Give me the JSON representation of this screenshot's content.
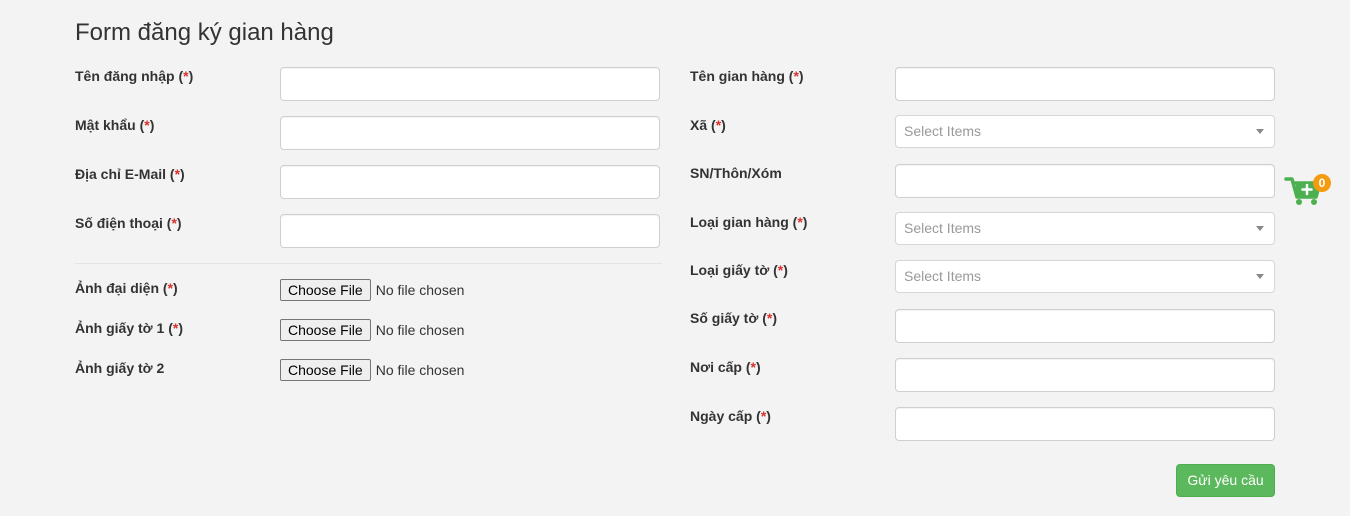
{
  "form": {
    "title": "Form đăng ký gian hàng",
    "required_mark": "*",
    "left_fields": [
      {
        "label": "Tên đăng nhập",
        "required": true,
        "value": ""
      },
      {
        "label": "Mật khẩu",
        "required": true,
        "value": ""
      },
      {
        "label": "Địa chỉ E-Mail",
        "required": true,
        "value": ""
      },
      {
        "label": "Số điện thoại",
        "required": true,
        "value": ""
      }
    ],
    "file_fields": [
      {
        "label": "Ảnh đại diện",
        "required": true,
        "button": "Choose File",
        "status": "No file chosen"
      },
      {
        "label": "Ảnh giấy tờ 1",
        "required": true,
        "button": "Choose File",
        "status": "No file chosen"
      },
      {
        "label": "Ảnh giấy tờ 2",
        "required": false,
        "button": "Choose File",
        "status": "No file chosen"
      }
    ],
    "right_fields": [
      {
        "label": "Tên gian hàng",
        "required": true,
        "type": "text",
        "value": ""
      },
      {
        "label": "Xã",
        "required": true,
        "type": "select",
        "placeholder": "Select Items"
      },
      {
        "label": "SN/Thôn/Xóm",
        "required": false,
        "type": "text",
        "value": ""
      },
      {
        "label": "Loại gian hàng",
        "required": true,
        "type": "select",
        "placeholder": "Select Items"
      },
      {
        "label": "Loại giấy tờ",
        "required": true,
        "type": "select",
        "placeholder": "Select Items"
      },
      {
        "label": "Số giấy tờ",
        "required": true,
        "type": "text",
        "value": ""
      },
      {
        "label": "Nơi cấp",
        "required": true,
        "type": "text",
        "value": ""
      },
      {
        "label": "Ngày cấp",
        "required": true,
        "type": "text",
        "value": ""
      }
    ],
    "submit_label": "Gửi yêu cầu"
  },
  "cart": {
    "icon": "cart-plus-icon",
    "count": "0",
    "color": "#4caf50",
    "badge_color": "#f39c12"
  },
  "colors": {
    "required": "#d9302c",
    "submit": "#5cb85c",
    "background": "#f3f3f3"
  }
}
